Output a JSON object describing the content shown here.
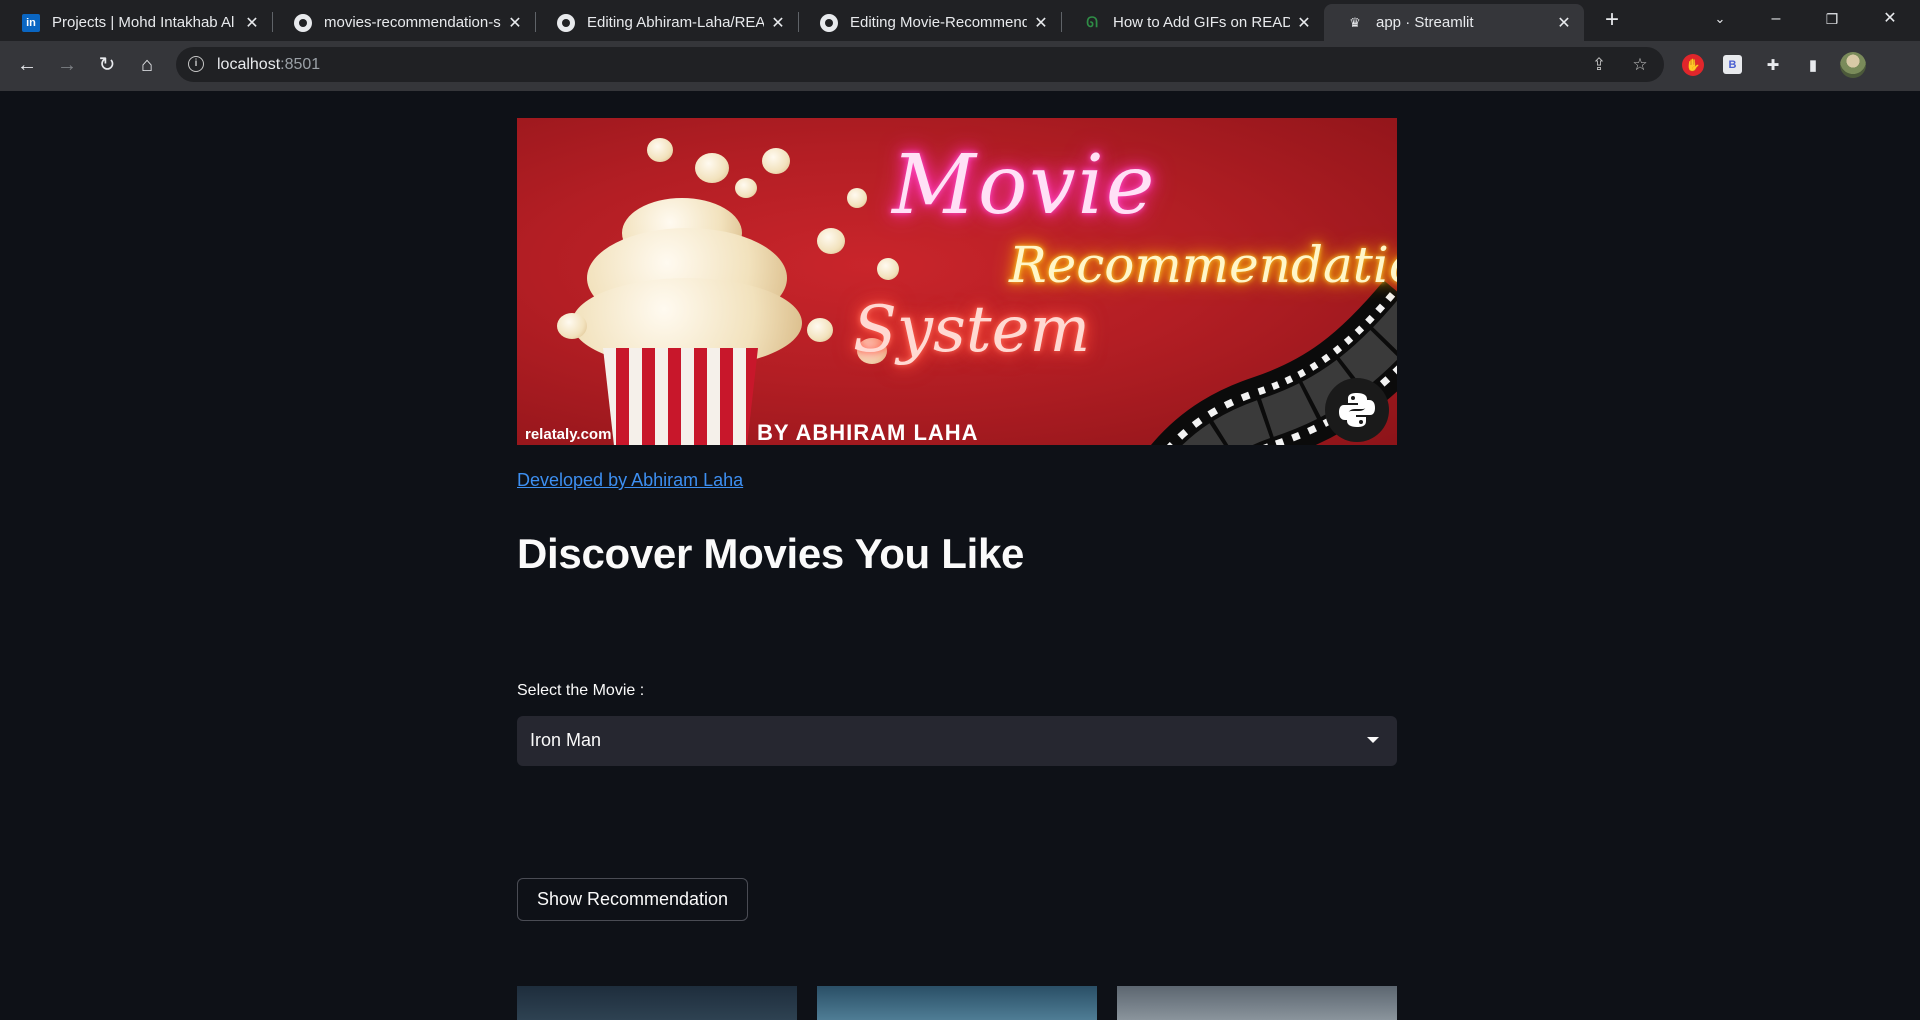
{
  "browser": {
    "tabs": [
      {
        "title": "Projects | Mohd Intakhab Al",
        "icon": "linkedin-icon"
      },
      {
        "title": "movies-recommendation-sy",
        "icon": "github-icon"
      },
      {
        "title": "Editing Abhiram-Laha/READ",
        "icon": "github-icon"
      },
      {
        "title": "Editing Movie-Recommend",
        "icon": "github-icon"
      },
      {
        "title": "How to Add GIFs on READM",
        "icon": "geeksforgeeks-icon"
      },
      {
        "title": "app · Streamlit",
        "icon": "streamlit-icon"
      }
    ],
    "address": {
      "host": "localhost",
      "port": ":8501"
    }
  },
  "banner": {
    "movie": "Movie",
    "recommendation": "Recommendation",
    "system": "System",
    "byline": "BY ABHIRAM LAHA",
    "watermark": "relataly.com"
  },
  "app": {
    "dev_link": "Developed by Abhiram Laha",
    "title": "Discover Movies You Like",
    "select_label": "Select the Movie :",
    "selected_movie": "Iron Man",
    "button_label": "Show Recommendation"
  },
  "colors": {
    "background": "#0e1117",
    "link": "#3d8ff1",
    "select_bg": "#262730"
  }
}
